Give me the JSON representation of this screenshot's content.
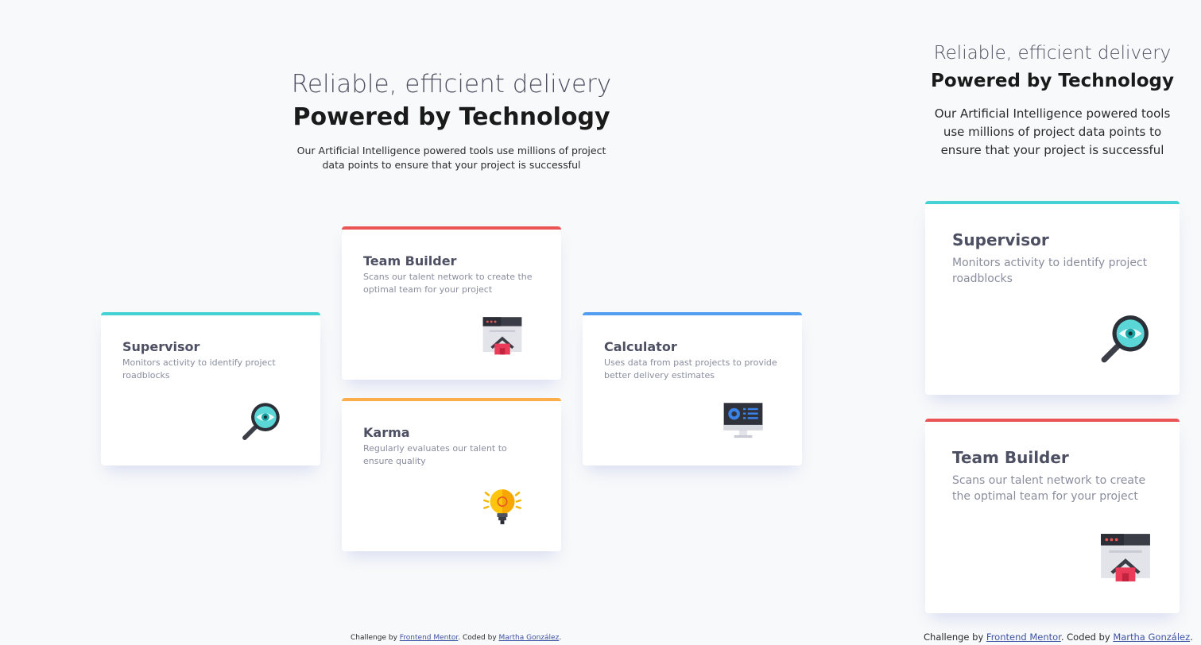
{
  "colors": {
    "cyan": "#44d3d2",
    "red": "#ea5454",
    "orange": "#fcae4a",
    "blue": "#549ef2"
  },
  "header": {
    "tagline": "Reliable, efficient delivery",
    "title": "Powered by Technology",
    "description": "Our Artificial Intelligence powered tools use millions of project data points to ensure that your project is successful"
  },
  "cards": {
    "supervisor": {
      "title": "Supervisor",
      "text": "Monitors activity to identify project roadblocks",
      "icon": "magnifier-eye-icon"
    },
    "team_builder": {
      "title": "Team Builder",
      "text": "Scans our talent network to create the optimal team for your project",
      "icon": "team-builder-icon"
    },
    "karma": {
      "title": "Karma",
      "text": "Regularly evaluates our talent to ensure quality",
      "icon": "lightbulb-icon"
    },
    "calculator": {
      "title": "Calculator",
      "text": "Uses data from past projects to provide better delivery estimates",
      "icon": "calculator-monitor-icon"
    }
  },
  "attribution": {
    "prefix": "Challenge by",
    "link1": "Frontend Mentor",
    "middle": ". Coded by",
    "link2": "Martha González",
    "suffix": "."
  }
}
